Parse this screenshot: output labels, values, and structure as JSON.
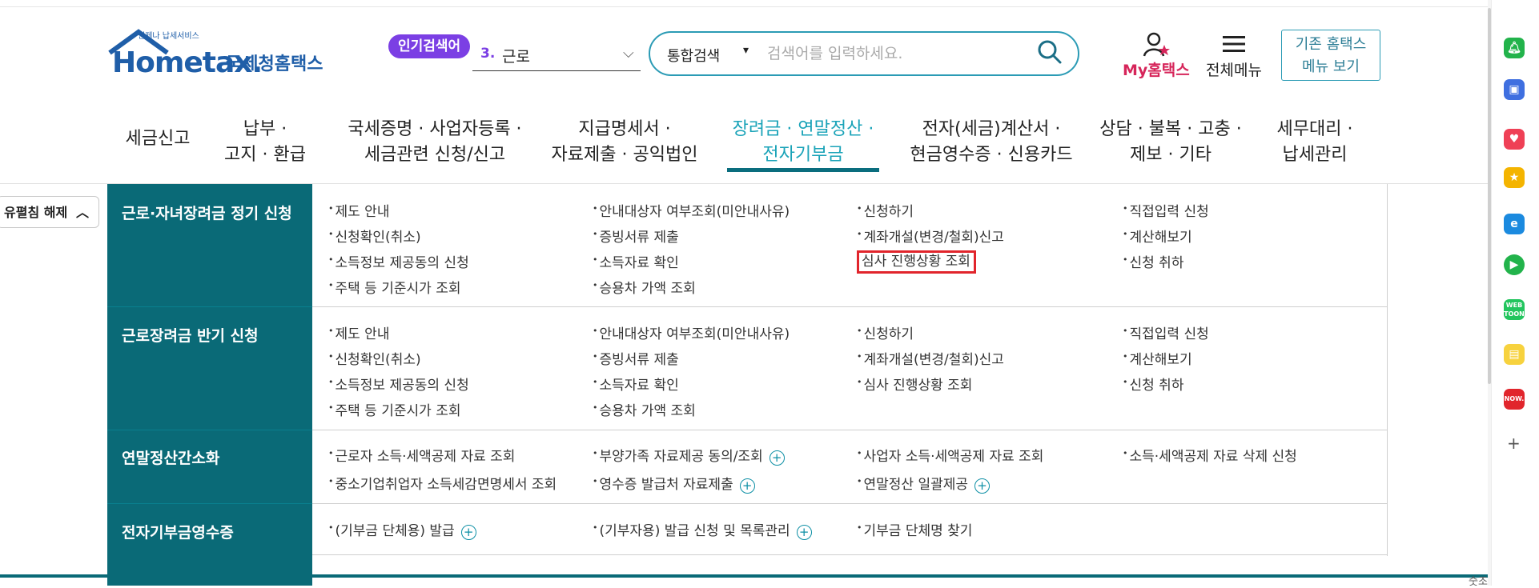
{
  "header": {
    "logo": {
      "sub": "언제나 납세서비스",
      "word": "Hometax.",
      "name_kr": "국세청홈택스"
    },
    "popular": {
      "badge": "인기검색어",
      "rank": "3.",
      "keyword": "근로"
    },
    "search": {
      "category": "통합검색",
      "placeholder": "검색어를 입력하세요."
    },
    "mytax_label": "My홈택스",
    "menu_label": "전체메뉴",
    "old_btn": {
      "line1": "기존 홈택스",
      "line2": "메뉴 보기"
    }
  },
  "nav": {
    "items": [
      {
        "line1": "세금신고",
        "line2": ""
      },
      {
        "line1": "납부 ·",
        "line2": "고지 · 환급"
      },
      {
        "line1": "국세증명 · 사업자등록 ·",
        "line2": "세금관련 신청/신고"
      },
      {
        "line1": "지급명세서 ·",
        "line2": "자료제출 · 공익법인"
      },
      {
        "line1": "장려금 · 연말정산 ·",
        "line2": "전자기부금"
      },
      {
        "line1": "전자(세금)계산서 ·",
        "line2": "현금영수증 · 신용카드"
      },
      {
        "line1": "상담 · 불복 · 고충 ·",
        "line2": "제보 · 기타"
      },
      {
        "line1": "세무대리 ·",
        "line2": "납세관리"
      }
    ],
    "active_index": 4
  },
  "fold_label": "유펼침 해제",
  "sections": [
    {
      "title": "근로·자녀장려금 정기 신청",
      "items": [
        "제도 안내",
        "안내대상자 여부조회(미안내사유)",
        "신청하기",
        "직접입력 신청",
        "신청확인(취소)",
        "증빙서류 제출",
        "계좌개설(변경/철회)신고",
        "계산해보기",
        "소득정보 제공동의 신청",
        "소득자료 확인",
        "심사 진행상황 조회",
        "신청 취하",
        "주택 등 기준시가 조회",
        "승용차 가액 조회"
      ]
    },
    {
      "title": "근로장려금 반기 신청",
      "items": [
        "제도 안내",
        "안내대상자 여부조회(미안내사유)",
        "신청하기",
        "직접입력 신청",
        "신청확인(취소)",
        "증빙서류 제출",
        "계좌개설(변경/철회)신고",
        "계산해보기",
        "소득정보 제공동의 신청",
        "소득자료 확인",
        "심사 진행상황 조회",
        "신청 취하",
        "주택 등 기준시가 조회",
        "승용차 가액 조회"
      ]
    },
    {
      "title": "연말정산간소화",
      "items": [
        "근로자 소득·세액공제 자료 조회",
        "부양가족 자료제공 동의/조회",
        "사업자 소득·세액공제 자료 조회",
        "소득·세액공제 자료 삭제 신청",
        "중소기업취업자 소득세감면명세서 조회",
        "영수증 발급처 자료제출",
        "연말정산 일괄제공"
      ]
    },
    {
      "title": "전자기부금영수증",
      "items": [
        "(기부금 단체용) 발급",
        "(기부자용) 발급 신청 및 목록관리",
        "기부금 단체명 찾기"
      ]
    }
  ],
  "bottom_text": "숫조",
  "dock": {
    "icons": [
      "bell-icon",
      "briefcase-icon",
      "pocket-icon",
      "star-icon",
      "edge-icon",
      "play-icon",
      "webtoon-icon",
      "notes-icon",
      "now-icon"
    ],
    "labels": {
      "webtoon": "WEB TOON",
      "now": "NOW."
    }
  },
  "colors": {
    "teal": "#0a6a77",
    "accent": "#1aa3b8",
    "purple": "#7b3fe4",
    "pink": "#d6255a",
    "highlight": "#e1252c"
  }
}
